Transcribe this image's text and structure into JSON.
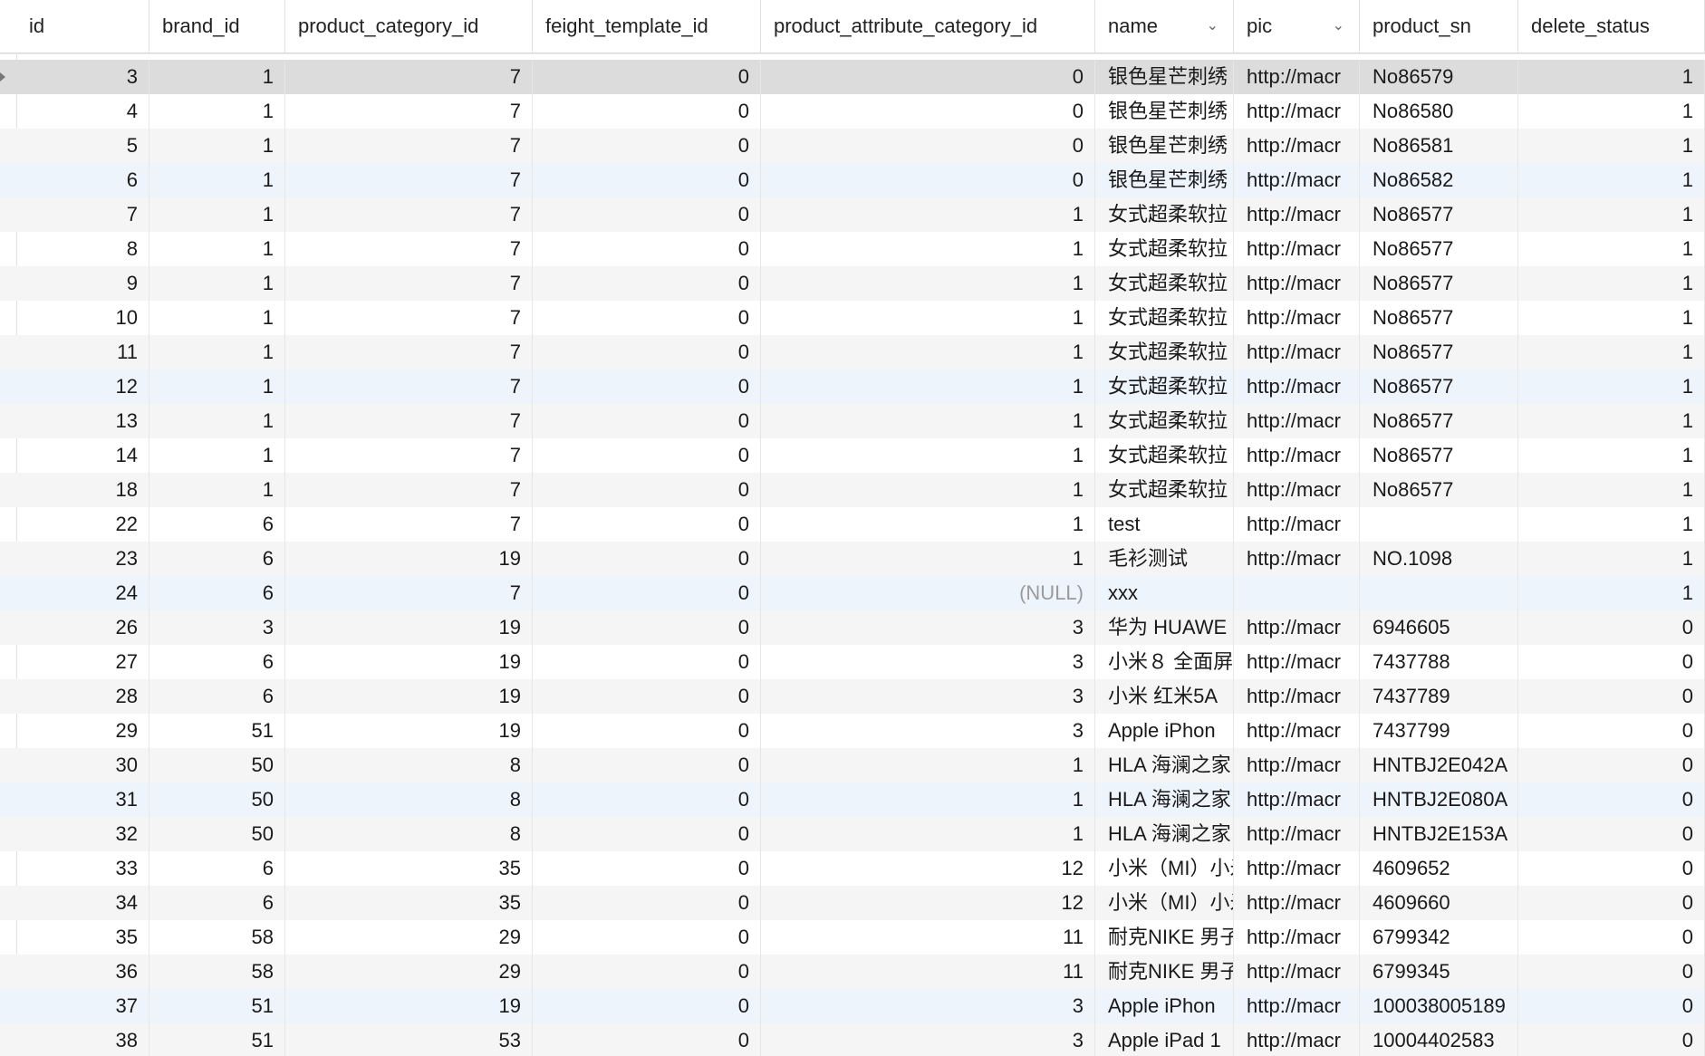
{
  "columns": [
    {
      "label": "id",
      "chevron": false
    },
    {
      "label": "brand_id",
      "chevron": false
    },
    {
      "label": "product_category_id",
      "chevron": false
    },
    {
      "label": "feight_template_id",
      "chevron": false
    },
    {
      "label": "product_attribute_category_id",
      "chevron": false
    },
    {
      "label": "name",
      "chevron": true
    },
    {
      "label": "pic",
      "chevron": true
    },
    {
      "label": "product_sn",
      "chevron": false
    },
    {
      "label": "delete_status",
      "chevron": false
    }
  ],
  "rows": [
    {
      "id": "3",
      "brand_id": "1",
      "product_category_id": "7",
      "feight_template_id": "0",
      "product_attribute_category_id": "0",
      "name": "银色星芒刺绣",
      "pic": "http://macr",
      "product_sn": "No86579",
      "delete_status": "1",
      "selected": true
    },
    {
      "id": "4",
      "brand_id": "1",
      "product_category_id": "7",
      "feight_template_id": "0",
      "product_attribute_category_id": "0",
      "name": "银色星芒刺绣",
      "pic": "http://macr",
      "product_sn": "No86580",
      "delete_status": "1"
    },
    {
      "id": "5",
      "brand_id": "1",
      "product_category_id": "7",
      "feight_template_id": "0",
      "product_attribute_category_id": "0",
      "name": "银色星芒刺绣",
      "pic": "http://macr",
      "product_sn": "No86581",
      "delete_status": "1"
    },
    {
      "id": "6",
      "brand_id": "1",
      "product_category_id": "7",
      "feight_template_id": "0",
      "product_attribute_category_id": "0",
      "name": "银色星芒刺绣",
      "pic": "http://macr",
      "product_sn": "No86582",
      "delete_status": "1"
    },
    {
      "id": "7",
      "brand_id": "1",
      "product_category_id": "7",
      "feight_template_id": "0",
      "product_attribute_category_id": "1",
      "name": "女式超柔软拉",
      "pic": "http://macr",
      "product_sn": "No86577",
      "delete_status": "1"
    },
    {
      "id": "8",
      "brand_id": "1",
      "product_category_id": "7",
      "feight_template_id": "0",
      "product_attribute_category_id": "1",
      "name": "女式超柔软拉",
      "pic": "http://macr",
      "product_sn": "No86577",
      "delete_status": "1"
    },
    {
      "id": "9",
      "brand_id": "1",
      "product_category_id": "7",
      "feight_template_id": "0",
      "product_attribute_category_id": "1",
      "name": "女式超柔软拉",
      "pic": "http://macr",
      "product_sn": "No86577",
      "delete_status": "1"
    },
    {
      "id": "10",
      "brand_id": "1",
      "product_category_id": "7",
      "feight_template_id": "0",
      "product_attribute_category_id": "1",
      "name": "女式超柔软拉",
      "pic": "http://macr",
      "product_sn": "No86577",
      "delete_status": "1"
    },
    {
      "id": "11",
      "brand_id": "1",
      "product_category_id": "7",
      "feight_template_id": "0",
      "product_attribute_category_id": "1",
      "name": "女式超柔软拉",
      "pic": "http://macr",
      "product_sn": "No86577",
      "delete_status": "1"
    },
    {
      "id": "12",
      "brand_id": "1",
      "product_category_id": "7",
      "feight_template_id": "0",
      "product_attribute_category_id": "1",
      "name": "女式超柔软拉",
      "pic": "http://macr",
      "product_sn": "No86577",
      "delete_status": "1"
    },
    {
      "id": "13",
      "brand_id": "1",
      "product_category_id": "7",
      "feight_template_id": "0",
      "product_attribute_category_id": "1",
      "name": "女式超柔软拉",
      "pic": "http://macr",
      "product_sn": "No86577",
      "delete_status": "1"
    },
    {
      "id": "14",
      "brand_id": "1",
      "product_category_id": "7",
      "feight_template_id": "0",
      "product_attribute_category_id": "1",
      "name": "女式超柔软拉",
      "pic": "http://macr",
      "product_sn": "No86577",
      "delete_status": "1"
    },
    {
      "id": "18",
      "brand_id": "1",
      "product_category_id": "7",
      "feight_template_id": "0",
      "product_attribute_category_id": "1",
      "name": "女式超柔软拉",
      "pic": "http://macr",
      "product_sn": "No86577",
      "delete_status": "1"
    },
    {
      "id": "22",
      "brand_id": "6",
      "product_category_id": "7",
      "feight_template_id": "0",
      "product_attribute_category_id": "1",
      "name": "test",
      "pic": "http://macr",
      "product_sn": "",
      "delete_status": "1"
    },
    {
      "id": "23",
      "brand_id": "6",
      "product_category_id": "19",
      "feight_template_id": "0",
      "product_attribute_category_id": "1",
      "name": "毛衫测试",
      "pic": "http://macr",
      "product_sn": "NO.1098",
      "delete_status": "1"
    },
    {
      "id": "24",
      "brand_id": "6",
      "product_category_id": "7",
      "feight_template_id": "0",
      "product_attribute_category_id": "(NULL)",
      "name": "xxx",
      "pic": "",
      "product_sn": "",
      "delete_status": "1",
      "null_attr": true
    },
    {
      "id": "26",
      "brand_id": "3",
      "product_category_id": "19",
      "feight_template_id": "0",
      "product_attribute_category_id": "3",
      "name": "华为 HUAWE",
      "pic": "http://macr",
      "product_sn": "6946605",
      "delete_status": "0"
    },
    {
      "id": "27",
      "brand_id": "6",
      "product_category_id": "19",
      "feight_template_id": "0",
      "product_attribute_category_id": "3",
      "name": "小米８ 全面屏",
      "pic": "http://macr",
      "product_sn": "7437788",
      "delete_status": "0"
    },
    {
      "id": "28",
      "brand_id": "6",
      "product_category_id": "19",
      "feight_template_id": "0",
      "product_attribute_category_id": "3",
      "name": "小米 红米5A",
      "pic": "http://macr",
      "product_sn": "7437789",
      "delete_status": "0"
    },
    {
      "id": "29",
      "brand_id": "51",
      "product_category_id": "19",
      "feight_template_id": "0",
      "product_attribute_category_id": "3",
      "name": "Apple iPhon",
      "pic": "http://macr",
      "product_sn": "7437799",
      "delete_status": "0"
    },
    {
      "id": "30",
      "brand_id": "50",
      "product_category_id": "8",
      "feight_template_id": "0",
      "product_attribute_category_id": "1",
      "name": "HLA 海澜之家",
      "pic": "http://macr",
      "product_sn": "HNTBJ2E042A",
      "delete_status": "0"
    },
    {
      "id": "31",
      "brand_id": "50",
      "product_category_id": "8",
      "feight_template_id": "0",
      "product_attribute_category_id": "1",
      "name": "HLA 海澜之家",
      "pic": "http://macr",
      "product_sn": "HNTBJ2E080A",
      "delete_status": "0"
    },
    {
      "id": "32",
      "brand_id": "50",
      "product_category_id": "8",
      "feight_template_id": "0",
      "product_attribute_category_id": "1",
      "name": "HLA 海澜之家",
      "pic": "http://macr",
      "product_sn": "HNTBJ2E153A",
      "delete_status": "0"
    },
    {
      "id": "33",
      "brand_id": "6",
      "product_category_id": "35",
      "feight_template_id": "0",
      "product_attribute_category_id": "12",
      "name": "小米（MI）小米",
      "pic": "http://macr",
      "product_sn": "4609652",
      "delete_status": "0"
    },
    {
      "id": "34",
      "brand_id": "6",
      "product_category_id": "35",
      "feight_template_id": "0",
      "product_attribute_category_id": "12",
      "name": "小米（MI）小米",
      "pic": "http://macr",
      "product_sn": "4609660",
      "delete_status": "0"
    },
    {
      "id": "35",
      "brand_id": "58",
      "product_category_id": "29",
      "feight_template_id": "0",
      "product_attribute_category_id": "11",
      "name": "耐克NIKE 男子",
      "pic": "http://macr",
      "product_sn": "6799342",
      "delete_status": "0"
    },
    {
      "id": "36",
      "brand_id": "58",
      "product_category_id": "29",
      "feight_template_id": "0",
      "product_attribute_category_id": "11",
      "name": "耐克NIKE 男子",
      "pic": "http://macr",
      "product_sn": "6799345",
      "delete_status": "0"
    },
    {
      "id": "37",
      "brand_id": "51",
      "product_category_id": "19",
      "feight_template_id": "0",
      "product_attribute_category_id": "3",
      "name": "Apple iPhon",
      "pic": "http://macr",
      "product_sn": "100038005189",
      "delete_status": "0"
    },
    {
      "id": "38",
      "brand_id": "51",
      "product_category_id": "53",
      "feight_template_id": "0",
      "product_attribute_category_id": "3",
      "name": "Apple iPad 1",
      "pic": "http://macr",
      "product_sn": "10004402583",
      "delete_status": "0"
    }
  ]
}
